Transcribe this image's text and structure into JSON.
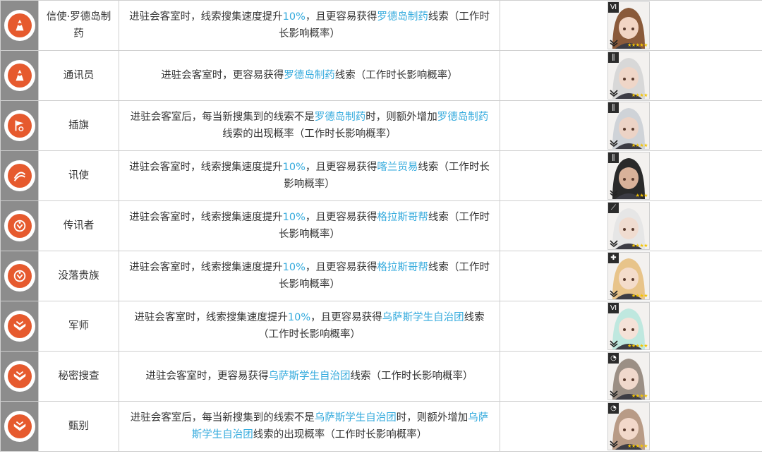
{
  "rows": [
    {
      "icon": "building-skill-rhodes-icon",
      "name": "信使·罗德岛制药",
      "desc": [
        {
          "t": "进驻会客室时，线索搜集速度提升"
        },
        {
          "t": "10%",
          "hl": true
        },
        {
          "t": "，且更容易获得"
        },
        {
          "t": "罗德岛制药",
          "hl": true
        },
        {
          "t": "线索（工作时长影响概率）"
        }
      ],
      "operator": {
        "portrait": "operator-portrait",
        "hair": "#8a5a3a",
        "skin": "#f2d5c4",
        "class_icon": "specialist-class-icon",
        "stars": "★★★★★"
      }
    },
    {
      "icon": "building-skill-rhodes-icon",
      "name": "通讯员",
      "desc": [
        {
          "t": "进驻会客室时，更容易获得"
        },
        {
          "t": "罗德岛制药",
          "hl": true
        },
        {
          "t": "线索（工作时长影响概率）"
        }
      ],
      "operator": {
        "portrait": "operator-portrait",
        "hair": "#d8d8d8",
        "skin": "#efd6c8",
        "class_icon": "guard-class-icon",
        "stars": "★★★★"
      }
    },
    {
      "icon": "building-skill-flag-icon",
      "name": "插旗",
      "desc": [
        {
          "t": "进驻会客室后，每当新搜集到的线索不是"
        },
        {
          "t": "罗德岛制药",
          "hl": true
        },
        {
          "t": "时，则额外增加"
        },
        {
          "t": "罗德岛制药",
          "hl": true
        },
        {
          "t": "线索的出现概率（工作时长影响概率）"
        }
      ],
      "operator": {
        "portrait": "operator-portrait",
        "hair": "#cfd3d8",
        "skin": "#ecd3c6",
        "class_icon": "guard-class-icon",
        "stars": "★★★★"
      }
    },
    {
      "icon": "building-skill-kazimierz-icon",
      "name": "讯使",
      "desc": [
        {
          "t": "进驻会客室时，线索搜集速度提升"
        },
        {
          "t": "10%",
          "hl": true
        },
        {
          "t": "，且更容易获得"
        },
        {
          "t": "喀兰贸易",
          "hl": true
        },
        {
          "t": "线索（工作时长影响概率）"
        }
      ],
      "operator": {
        "portrait": "operator-portrait",
        "hair": "#2a2a2a",
        "skin": "#d9b29a",
        "class_icon": "guard-class-icon",
        "stars": "★★★"
      }
    },
    {
      "icon": "building-skill-glasgow-icon",
      "name": "传讯者",
      "desc": [
        {
          "t": "进驻会客室时，线索搜集速度提升"
        },
        {
          "t": "10%",
          "hl": true
        },
        {
          "t": "，且更容易获得"
        },
        {
          "t": "格拉斯哥帮",
          "hl": true
        },
        {
          "t": "线索（工作时长影响概率）"
        }
      ],
      "operator": {
        "portrait": "operator-portrait",
        "hair": "#e6e6e6",
        "skin": "#f0dcd0",
        "class_icon": "sniper-class-icon",
        "stars": "★★★★"
      }
    },
    {
      "icon": "building-skill-glasgow-icon",
      "name": "没落贵族",
      "desc": [
        {
          "t": "进驻会客室时，线索搜集速度提升"
        },
        {
          "t": "10%",
          "hl": true
        },
        {
          "t": "，且更容易获得"
        },
        {
          "t": "格拉斯哥帮",
          "hl": true
        },
        {
          "t": "线索（工作时长影响概率）"
        }
      ],
      "operator": {
        "portrait": "operator-portrait",
        "hair": "#e8c48a",
        "skin": "#f4dccb",
        "class_icon": "medic-class-icon",
        "stars": "★★★★"
      }
    },
    {
      "icon": "building-skill-ursus-icon",
      "name": "军师",
      "desc": [
        {
          "t": "进驻会客室时，线索搜集速度提升"
        },
        {
          "t": "10%",
          "hl": true
        },
        {
          "t": "，且更容易获得"
        },
        {
          "t": "乌萨斯学生自治团",
          "hl": true
        },
        {
          "t": "线索（工作时长影响概率）"
        }
      ],
      "operator": {
        "portrait": "operator-portrait",
        "hair": "#bfe8df",
        "skin": "#f5e2d8",
        "class_icon": "specialist-class-icon",
        "stars": "★★★★★"
      }
    },
    {
      "icon": "building-skill-ursus-icon",
      "name": "秘密搜查",
      "desc": [
        {
          "t": "进驻会客室时，更容易获得"
        },
        {
          "t": "乌萨斯学生自治团",
          "hl": true
        },
        {
          "t": "线索（工作时长影响概率）"
        }
      ],
      "operator": {
        "portrait": "operator-portrait",
        "hair": "#9b8f85",
        "skin": "#f0d8cc",
        "class_icon": "caster-class-icon",
        "stars": "★★★★"
      }
    },
    {
      "icon": "building-skill-ursus-icon",
      "name": "甄别",
      "desc": [
        {
          "t": "进驻会客室后，每当新搜集到的线索不是"
        },
        {
          "t": "乌萨斯学生自治团",
          "hl": true
        },
        {
          "t": "时，则额外增加"
        },
        {
          "t": "乌萨斯学生自治团",
          "hl": true
        },
        {
          "t": "线索的出现概率（工作时长影响概率）"
        }
      ],
      "operator": {
        "portrait": "operator-portrait",
        "hair": "#b89b86",
        "skin": "#f2d8ca",
        "class_icon": "caster-class-icon",
        "stars": "★★★★★"
      }
    }
  ],
  "colors": {
    "accent": "#e65a2e",
    "highlight": "#33aadd",
    "sidebar": "#8c8c8c",
    "border": "#cfcfcf"
  }
}
